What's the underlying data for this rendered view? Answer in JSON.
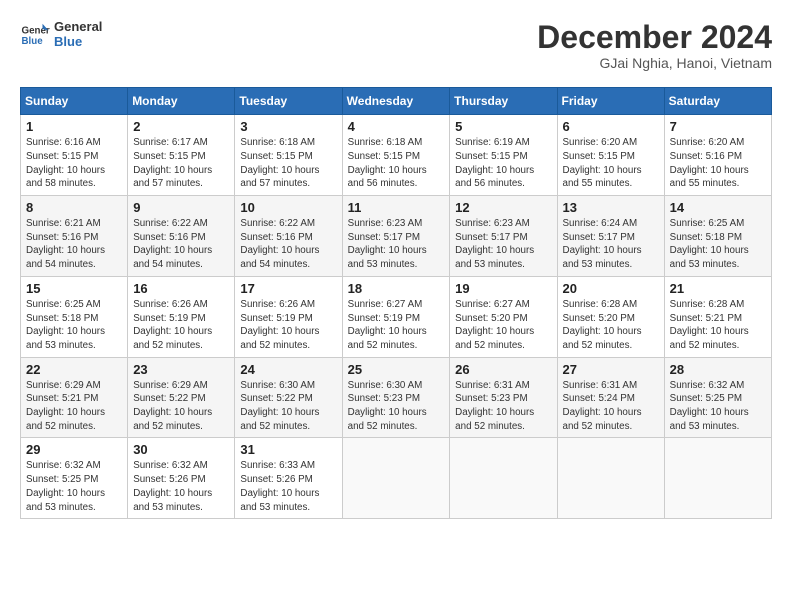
{
  "header": {
    "logo_line1": "General",
    "logo_line2": "Blue",
    "month_title": "December 2024",
    "location": "GJai Nghia, Hanoi, Vietnam"
  },
  "weekdays": [
    "Sunday",
    "Monday",
    "Tuesday",
    "Wednesday",
    "Thursday",
    "Friday",
    "Saturday"
  ],
  "weeks": [
    [
      {
        "day": "1",
        "info": "Sunrise: 6:16 AM\nSunset: 5:15 PM\nDaylight: 10 hours\nand 58 minutes."
      },
      {
        "day": "2",
        "info": "Sunrise: 6:17 AM\nSunset: 5:15 PM\nDaylight: 10 hours\nand 57 minutes."
      },
      {
        "day": "3",
        "info": "Sunrise: 6:18 AM\nSunset: 5:15 PM\nDaylight: 10 hours\nand 57 minutes."
      },
      {
        "day": "4",
        "info": "Sunrise: 6:18 AM\nSunset: 5:15 PM\nDaylight: 10 hours\nand 56 minutes."
      },
      {
        "day": "5",
        "info": "Sunrise: 6:19 AM\nSunset: 5:15 PM\nDaylight: 10 hours\nand 56 minutes."
      },
      {
        "day": "6",
        "info": "Sunrise: 6:20 AM\nSunset: 5:15 PM\nDaylight: 10 hours\nand 55 minutes."
      },
      {
        "day": "7",
        "info": "Sunrise: 6:20 AM\nSunset: 5:16 PM\nDaylight: 10 hours\nand 55 minutes."
      }
    ],
    [
      {
        "day": "8",
        "info": "Sunrise: 6:21 AM\nSunset: 5:16 PM\nDaylight: 10 hours\nand 54 minutes."
      },
      {
        "day": "9",
        "info": "Sunrise: 6:22 AM\nSunset: 5:16 PM\nDaylight: 10 hours\nand 54 minutes."
      },
      {
        "day": "10",
        "info": "Sunrise: 6:22 AM\nSunset: 5:16 PM\nDaylight: 10 hours\nand 54 minutes."
      },
      {
        "day": "11",
        "info": "Sunrise: 6:23 AM\nSunset: 5:17 PM\nDaylight: 10 hours\nand 53 minutes."
      },
      {
        "day": "12",
        "info": "Sunrise: 6:23 AM\nSunset: 5:17 PM\nDaylight: 10 hours\nand 53 minutes."
      },
      {
        "day": "13",
        "info": "Sunrise: 6:24 AM\nSunset: 5:17 PM\nDaylight: 10 hours\nand 53 minutes."
      },
      {
        "day": "14",
        "info": "Sunrise: 6:25 AM\nSunset: 5:18 PM\nDaylight: 10 hours\nand 53 minutes."
      }
    ],
    [
      {
        "day": "15",
        "info": "Sunrise: 6:25 AM\nSunset: 5:18 PM\nDaylight: 10 hours\nand 53 minutes."
      },
      {
        "day": "16",
        "info": "Sunrise: 6:26 AM\nSunset: 5:19 PM\nDaylight: 10 hours\nand 52 minutes."
      },
      {
        "day": "17",
        "info": "Sunrise: 6:26 AM\nSunset: 5:19 PM\nDaylight: 10 hours\nand 52 minutes."
      },
      {
        "day": "18",
        "info": "Sunrise: 6:27 AM\nSunset: 5:19 PM\nDaylight: 10 hours\nand 52 minutes."
      },
      {
        "day": "19",
        "info": "Sunrise: 6:27 AM\nSunset: 5:20 PM\nDaylight: 10 hours\nand 52 minutes."
      },
      {
        "day": "20",
        "info": "Sunrise: 6:28 AM\nSunset: 5:20 PM\nDaylight: 10 hours\nand 52 minutes."
      },
      {
        "day": "21",
        "info": "Sunrise: 6:28 AM\nSunset: 5:21 PM\nDaylight: 10 hours\nand 52 minutes."
      }
    ],
    [
      {
        "day": "22",
        "info": "Sunrise: 6:29 AM\nSunset: 5:21 PM\nDaylight: 10 hours\nand 52 minutes."
      },
      {
        "day": "23",
        "info": "Sunrise: 6:29 AM\nSunset: 5:22 PM\nDaylight: 10 hours\nand 52 minutes."
      },
      {
        "day": "24",
        "info": "Sunrise: 6:30 AM\nSunset: 5:22 PM\nDaylight: 10 hours\nand 52 minutes."
      },
      {
        "day": "25",
        "info": "Sunrise: 6:30 AM\nSunset: 5:23 PM\nDaylight: 10 hours\nand 52 minutes."
      },
      {
        "day": "26",
        "info": "Sunrise: 6:31 AM\nSunset: 5:23 PM\nDaylight: 10 hours\nand 52 minutes."
      },
      {
        "day": "27",
        "info": "Sunrise: 6:31 AM\nSunset: 5:24 PM\nDaylight: 10 hours\nand 52 minutes."
      },
      {
        "day": "28",
        "info": "Sunrise: 6:32 AM\nSunset: 5:25 PM\nDaylight: 10 hours\nand 53 minutes."
      }
    ],
    [
      {
        "day": "29",
        "info": "Sunrise: 6:32 AM\nSunset: 5:25 PM\nDaylight: 10 hours\nand 53 minutes."
      },
      {
        "day": "30",
        "info": "Sunrise: 6:32 AM\nSunset: 5:26 PM\nDaylight: 10 hours\nand 53 minutes."
      },
      {
        "day": "31",
        "info": "Sunrise: 6:33 AM\nSunset: 5:26 PM\nDaylight: 10 hours\nand 53 minutes."
      },
      null,
      null,
      null,
      null
    ]
  ]
}
